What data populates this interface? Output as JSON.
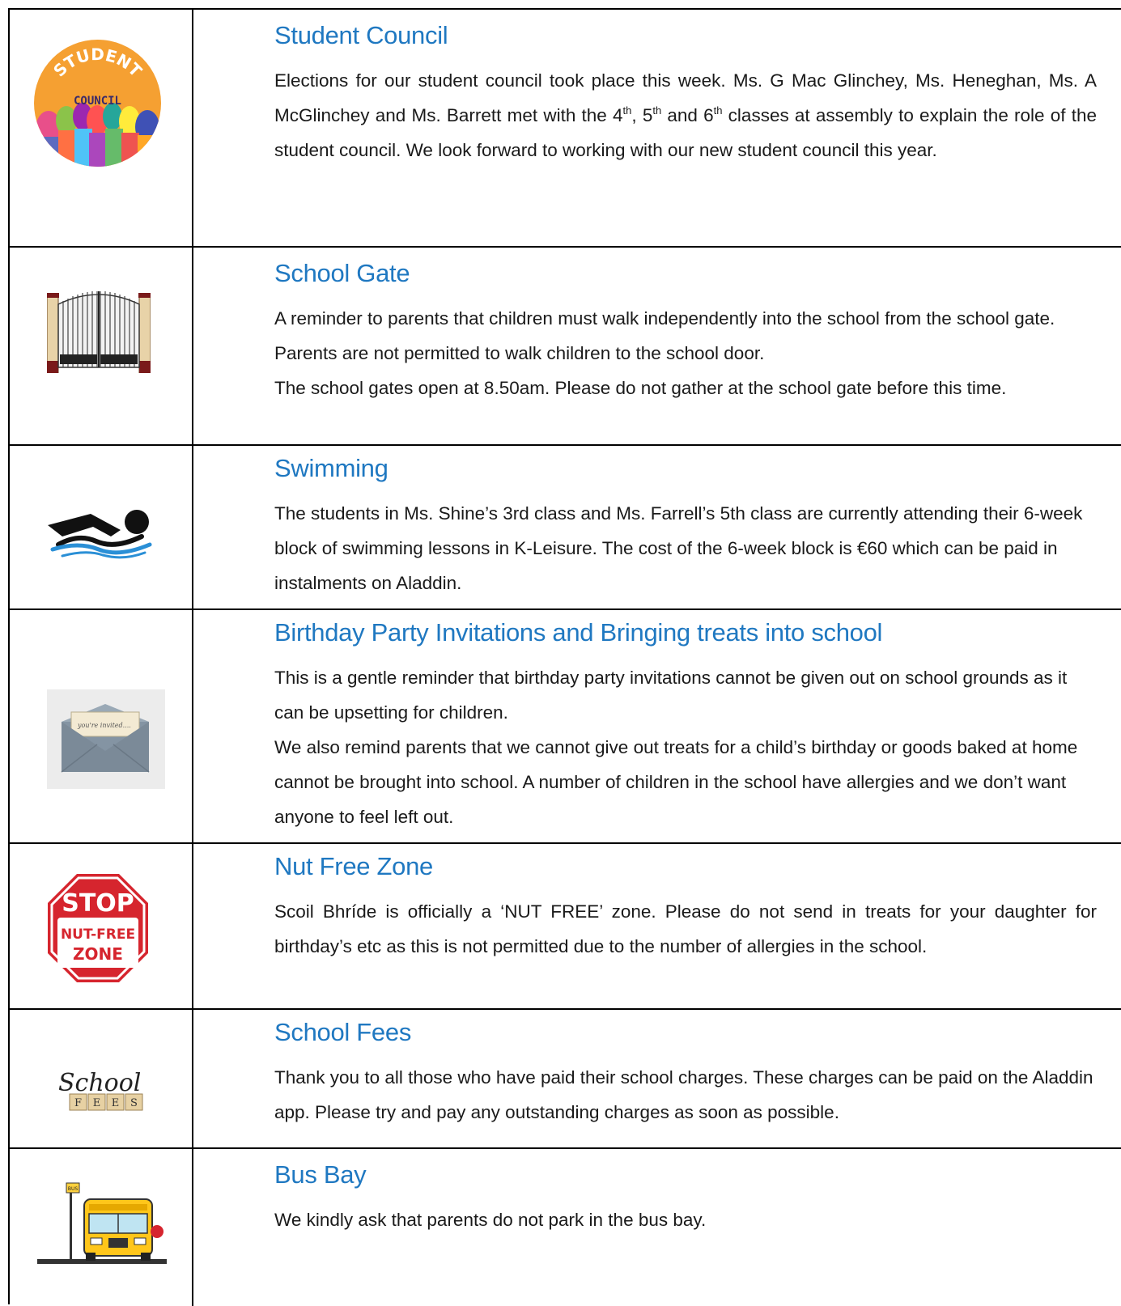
{
  "sections": [
    {
      "title": "Student Council",
      "icon": "student-council-badge",
      "icon_text_top": "STUDENT",
      "icon_text_mid": "COUNCIL",
      "paragraphs": [
        {
          "p1": "Elections for our student council took place this week. Ms. G Mac Glinchey, Ms. Heneghan, Ms. A McGlinchey and Ms. Barrett met with the 4",
          "s1": "th",
          "p2": ", 5",
          "s2": "th",
          "p3": " and 6",
          "s3": "th",
          "p4": " classes at assembly to explain the role of the student council. We look forward to working with our new student council this year."
        }
      ]
    },
    {
      "title": "School Gate",
      "icon": "school-gate-icon",
      "paragraphs": [
        "A reminder to parents that children must walk independently into the school from the school gate. Parents are not permitted to walk children to the school door.",
        "The school gates open at 8.50am. Please do not gather at the school gate before this time."
      ]
    },
    {
      "title": "Swimming",
      "icon": "swimmer-icon",
      "paragraphs": [
        "The students in Ms. Shine’s 3rd class and Ms. Farrell’s 5th class are currently attending their 6-week block of swimming lessons in K-Leisure. The cost of the 6-week block is €60 which can be paid in instalments on Aladdin."
      ]
    },
    {
      "title": "Birthday Party Invitations and Bringing treats into school",
      "icon": "invitation-envelope-icon",
      "icon_text": "you're invited....",
      "paragraphs": [
        "This is a gentle reminder that birthday party invitations cannot be given out on school grounds as it can be upsetting for children.",
        "We also remind parents that we cannot give out treats for a child’s birthday or goods baked at home cannot be brought into school. A number of children in the school have allergies and we don’t want anyone to feel left out."
      ]
    },
    {
      "title": "Nut Free Zone",
      "icon": "stop-sign-icon",
      "icon_text_1": "STOP",
      "icon_text_2": "NUT-FREE",
      "icon_text_3": "ZONE",
      "paragraphs": [
        "Scoil Bhríde is officially a ‘NUT FREE’ zone. Please do not send in treats for your daughter for birthday’s etc as this is not permitted due to the number of allergies in the school."
      ]
    },
    {
      "title": "School Fees",
      "icon": "school-fees-icon",
      "icon_text_1": "School",
      "icon_tiles": [
        "F",
        "E",
        "E",
        "S"
      ],
      "paragraphs": [
        "Thank you to all those who have paid their school charges. These charges can be paid on the Aladdin app. Please try and pay any outstanding charges as soon as possible."
      ]
    },
    {
      "title": "Bus Bay",
      "icon": "school-bus-icon",
      "icon_text_1": "BUS",
      "paragraphs": [
        "We kindly ask that parents do not park in the bus bay."
      ]
    }
  ],
  "colors": {
    "title": "#1f78c1",
    "body_text": "#1a1a1a",
    "border": "#000000"
  }
}
